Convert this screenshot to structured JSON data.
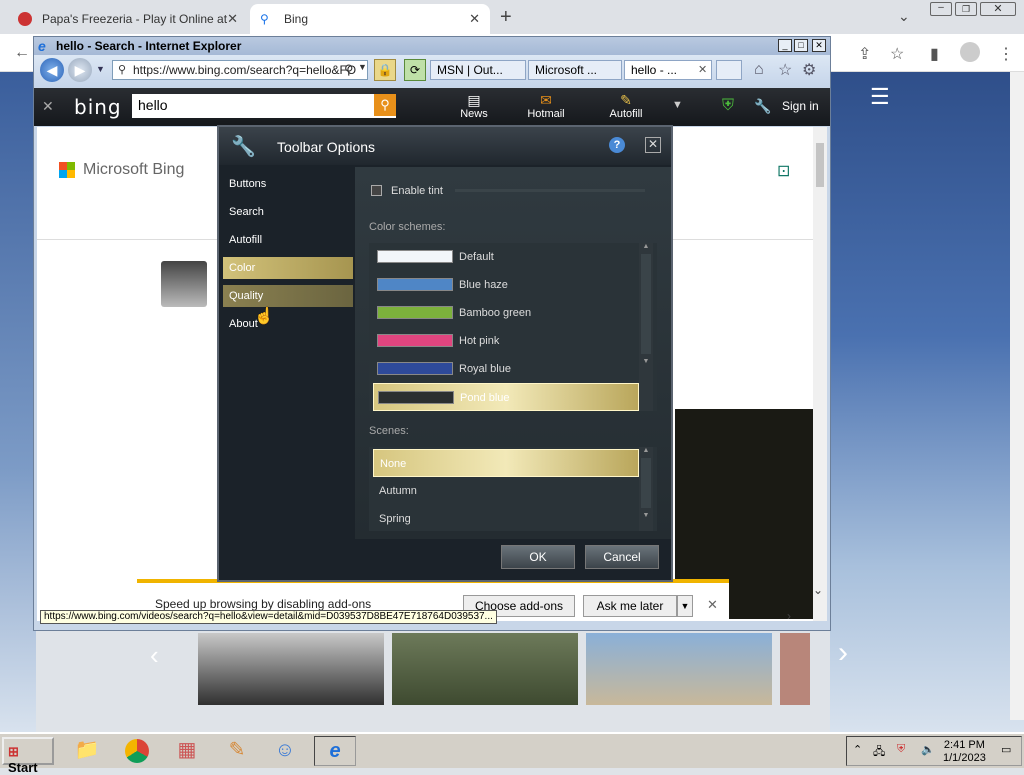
{
  "chrome": {
    "tabs": [
      {
        "title": "Papa's Freezeria - Play it Online at C"
      },
      {
        "title": "Bing"
      }
    ],
    "new_tab": "+"
  },
  "ie": {
    "title": "hello - Search - Internet Explorer",
    "url": "https://www.bing.com/search?q=hello&FO",
    "tabs": [
      "MSN | Out...",
      "Microsoft ...",
      "hello - ..."
    ]
  },
  "bing_toolbar": {
    "logo": "bing",
    "search_value": "hello",
    "items": [
      "News",
      "Hotmail",
      "Autofill"
    ],
    "sign_in": "Sign in"
  },
  "page": {
    "brand": "Microsoft Bing",
    "status_url": "https://www.bing.com/videos/search?q=hello&view=detail&mid=D039537D8BE47E718764D039537...",
    "notification": {
      "text": "Speed up browsing by disabling add-ons",
      "choose_button": "Choose add-ons",
      "later_button": "Ask me later"
    }
  },
  "dialog": {
    "title": "Toolbar Options",
    "nav": [
      "Buttons",
      "Search",
      "Autofill",
      "Color",
      "Quality",
      "About"
    ],
    "selected_nav": "Color",
    "enable_tint": "Enable tint",
    "color_schemes_label": "Color schemes:",
    "color_schemes": [
      {
        "name": "Default",
        "color": "#f2f6fa"
      },
      {
        "name": "Blue haze",
        "color": "#4f86c6"
      },
      {
        "name": "Bamboo green",
        "color": "#7cb13c"
      },
      {
        "name": "Hot pink",
        "color": "#e0457f"
      },
      {
        "name": "Royal blue",
        "color": "#2e4a9a"
      },
      {
        "name": "Pond blue",
        "color": "#2b2f30"
      }
    ],
    "selected_scheme": "Pond blue",
    "scenes_label": "Scenes:",
    "scenes": [
      "None",
      "Autumn",
      "Spring"
    ],
    "selected_scene": "None",
    "ok": "OK",
    "cancel": "Cancel"
  },
  "taskbar": {
    "start": "Start",
    "time": "2:41 PM",
    "date": "1/1/2023"
  }
}
